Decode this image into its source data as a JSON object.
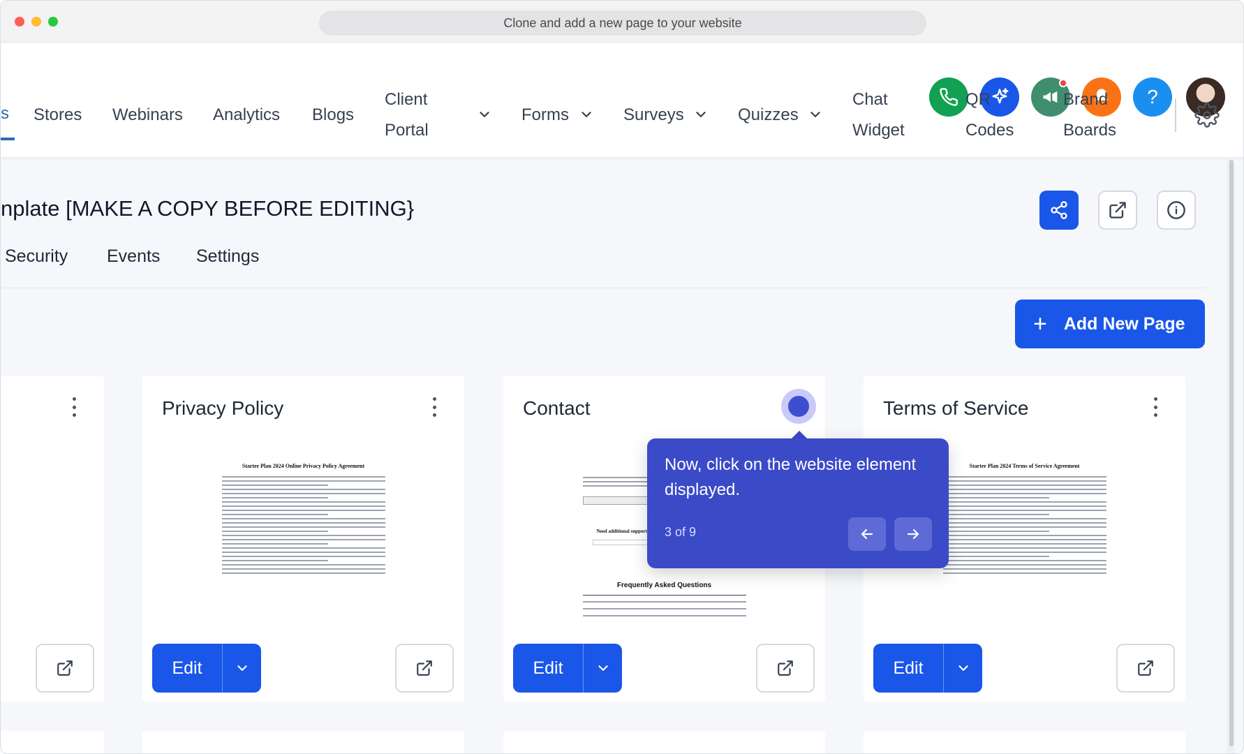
{
  "window": {
    "url_title": "Clone and add a new page to your website"
  },
  "header_icons": [
    {
      "name": "phone-icon",
      "color": "#12a152"
    },
    {
      "name": "sparkle-icon",
      "color": "#1a56e8"
    },
    {
      "name": "megaphone-icon",
      "color": "#3f8f6e"
    },
    {
      "name": "bell-icon",
      "color": "#f97316"
    },
    {
      "name": "help-icon",
      "color": "#1b8ff0",
      "glyph": "?"
    }
  ],
  "nav": {
    "active_fragment": "s",
    "items": [
      "Stores",
      "Webinars",
      "Analytics",
      "Blogs"
    ],
    "client_portal": [
      "Client",
      "Portal"
    ],
    "forms": "Forms",
    "surveys": "Surveys",
    "quizzes": "Quizzes",
    "chat_widget": [
      "Chat",
      "Widget"
    ],
    "qr_codes": [
      "QR",
      "Codes"
    ],
    "brand_boards": [
      "Brand",
      "Boards"
    ]
  },
  "page": {
    "title": "nplate [MAKE A COPY BEFORE EDITING}",
    "tabs": [
      "Security",
      "Events",
      "Settings"
    ],
    "add_button": "Add New Page",
    "add_button_icon": "+"
  },
  "cards": [
    {
      "title": ""
    },
    {
      "title": "Privacy Policy",
      "doc_title": "Starter Plan 2024 Online Privacy Policy Agreement",
      "edit": "Edit"
    },
    {
      "title": "Contact",
      "faq_title": "Frequently Asked Questions",
      "support_label": "Need additional support?",
      "edit": "Edit"
    },
    {
      "title": "Terms of Service",
      "doc_title": "Starter Plan 2024 Terms of Service Agreement",
      "edit": "Edit"
    }
  ],
  "tooltip": {
    "text": "Now, click on the website element displayed.",
    "step": "3 of 9"
  },
  "colors": {
    "primary": "#1a56e8",
    "tooltip": "#3b4ac7",
    "background": "#f5f7fa"
  }
}
